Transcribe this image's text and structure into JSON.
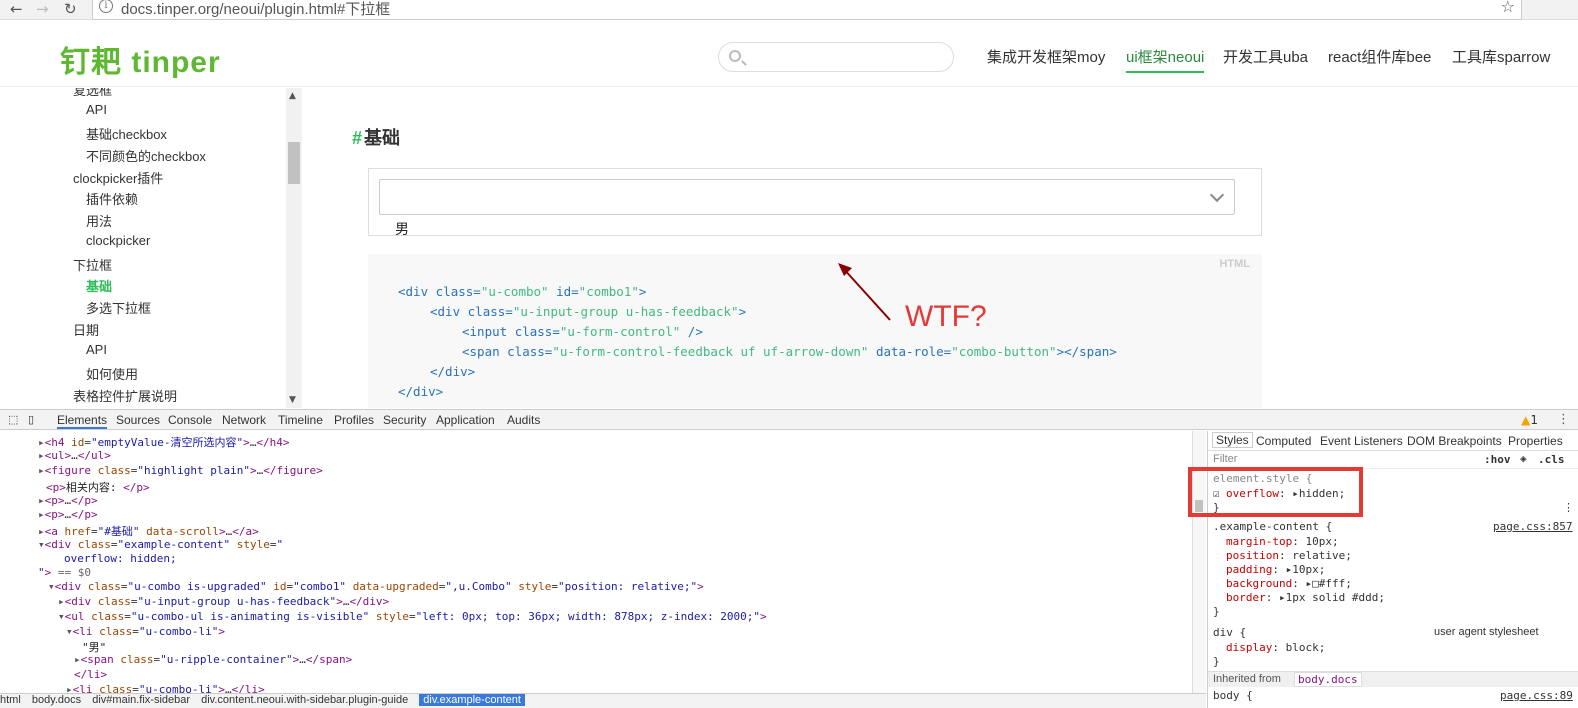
{
  "browser": {
    "back_icon": "←",
    "forward_icon": "→",
    "reload_icon": "↻",
    "url": "docs.tinper.org/neoui/plugin.html#下拉框",
    "star_icon": "☆"
  },
  "site": {
    "logo": "钉耙 tinper",
    "search_placeholder": "",
    "nav": [
      {
        "label": "集成开发框架moy"
      },
      {
        "label": "ui框架neoui"
      },
      {
        "label": "开发工具uba"
      },
      {
        "label": "react组件库bee"
      },
      {
        "label": "工具库sparrow"
      }
    ],
    "accent": "#2ebd5a"
  },
  "sidebar": {
    "items": [
      {
        "label": "复选框"
      },
      {
        "label": "API"
      },
      {
        "label": "基础checkbox"
      },
      {
        "label": "不同颜色的checkbox"
      },
      {
        "label": "clockpicker插件"
      },
      {
        "label": "插件依赖"
      },
      {
        "label": "用法"
      },
      {
        "label": "clockpicker"
      },
      {
        "label": "下拉框"
      },
      {
        "label": "基础"
      },
      {
        "label": "多选下拉框"
      },
      {
        "label": "日期"
      },
      {
        "label": "API"
      },
      {
        "label": "如何使用"
      },
      {
        "label": "表格控件扩展说明"
      }
    ],
    "up_icon": "▲",
    "down_icon": "▼"
  },
  "content": {
    "heading_hash": "#",
    "heading": "基础",
    "combo_option": "男",
    "code_lang": "HTML",
    "annotation": "WTF?"
  },
  "devtools": {
    "tabs": [
      "Elements",
      "Sources",
      "Console",
      "Network",
      "Timeline",
      "Profiles",
      "Security",
      "Application",
      "Audits"
    ],
    "warn_count": "1",
    "close_icon": "⋮",
    "breadcrumbs": [
      "html",
      "body.docs",
      "div#main.fix-sidebar",
      "div.content.neoui.with-sidebar.plugin-guide",
      "div.example-content"
    ],
    "styles_tabs": [
      "Styles",
      "Computed",
      "Event Listeners",
      "DOM Breakpoints",
      "Properties"
    ],
    "filter_label": "Filter",
    "hov": ":hov",
    "cls": ".cls",
    "element_style": "element.style {",
    "overflow_prop": "overflow",
    "overflow_val": "hidden;",
    "rule1_selector": ".example-content {",
    "rule1_source": "page.css:857",
    "rule1_props": [
      {
        "p": "margin-top",
        "v": "10px;"
      },
      {
        "p": "position",
        "v": "relative;"
      },
      {
        "p": "padding",
        "v": "10px;"
      },
      {
        "p": "background",
        "v": "#fff;"
      },
      {
        "p": "border",
        "v": "1px solid #ddd;"
      }
    ],
    "rule2_selector": "div {",
    "rule2_source": "user agent stylesheet",
    "rule2_prop": "display",
    "rule2_val": "block;",
    "inherited_label": "Inherited from",
    "inherited_val": "body.docs",
    "body_selector": "body {",
    "body_source": "page.css:89",
    "close_brace": "}"
  }
}
